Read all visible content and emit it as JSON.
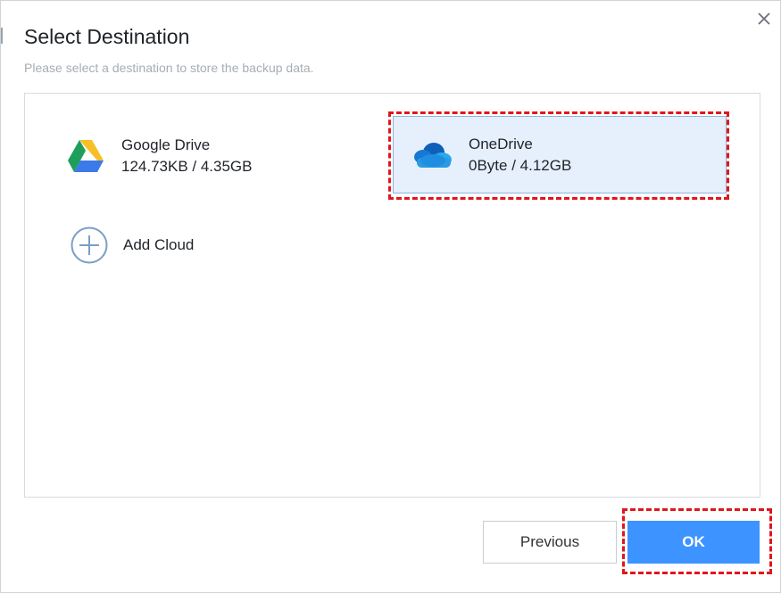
{
  "dialog": {
    "title": "Select Destination",
    "subtitle": "Please select a destination to store the backup data."
  },
  "destinations": [
    {
      "name": "Google Drive",
      "usage": "124.73KB / 4.35GB",
      "icon": "google-drive-icon",
      "selected": false
    },
    {
      "name": "OneDrive",
      "usage": "0Byte / 4.12GB",
      "icon": "onedrive-cloud-icon",
      "selected": true
    }
  ],
  "add_cloud": {
    "label": "Add Cloud",
    "icon": "plus-circle-icon"
  },
  "buttons": {
    "previous": "Previous",
    "ok": "OK"
  },
  "colors": {
    "accent": "#3d93ff",
    "selected_bg": "#e6f0fd",
    "highlight_outline": "#e0161c"
  }
}
